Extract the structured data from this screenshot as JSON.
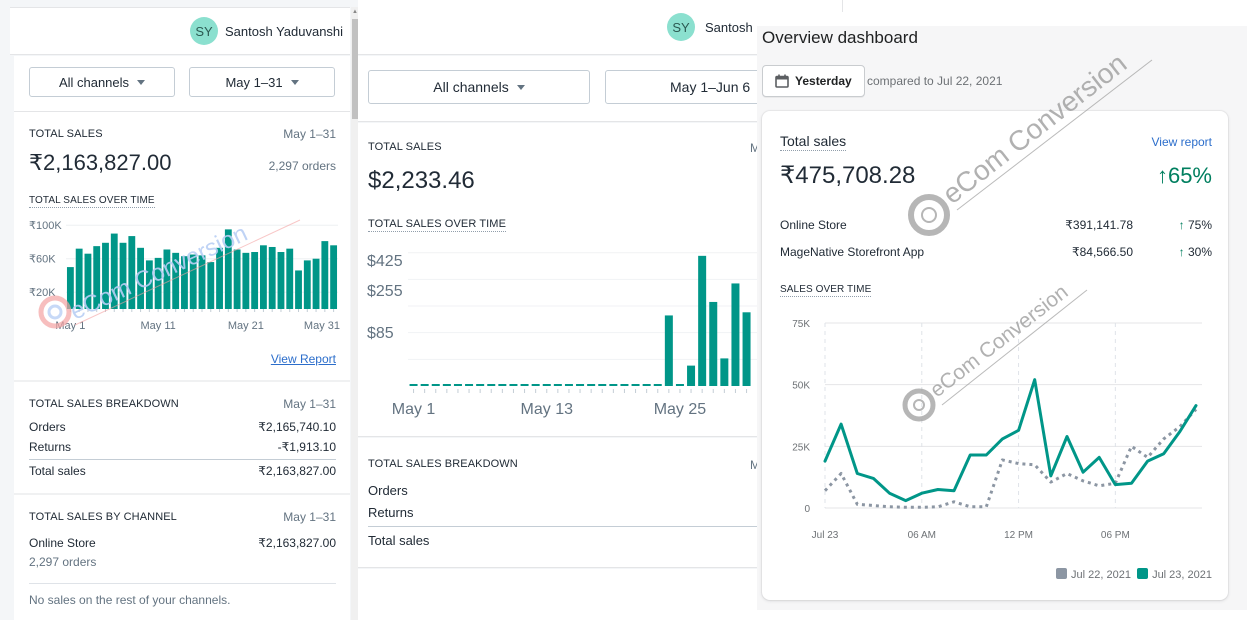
{
  "user": {
    "initials": "SY",
    "name": "Santosh Yaduvanshi",
    "name_short": "Santosh"
  },
  "panel1": {
    "filters": {
      "channel": "All channels",
      "date_range": "May 1–31"
    },
    "total_sales": {
      "label": "TOTAL SALES",
      "period": "May 1–31",
      "value": "₹2,163,827.00",
      "orders": "2,297 orders"
    },
    "chart_title": "TOTAL SALES OVER TIME",
    "view_report": "View Report",
    "breakdown": {
      "title": "TOTAL SALES BREAKDOWN",
      "period": "May 1–31",
      "rows": [
        {
          "label": "Orders",
          "value": "₹2,165,740.10"
        },
        {
          "label": "Returns",
          "value": "-₹1,913.10"
        },
        {
          "label": "Total sales",
          "value": "₹2,163,827.00"
        }
      ]
    },
    "by_channel": {
      "title": "TOTAL SALES BY CHANNEL",
      "period": "May 1–31",
      "channel": "Online Store",
      "value": "₹2,163,827.00",
      "orders": "2,297 orders",
      "note": "No sales on the rest of your channels."
    }
  },
  "panel2": {
    "filters": {
      "channel": "All channels",
      "date_range": "May 1–Jun 6"
    },
    "total_sales": {
      "label": "TOTAL SALES",
      "period_clipped": "M",
      "value": "$2,233.46"
    },
    "chart_title": "TOTAL SALES OVER TIME",
    "breakdown": {
      "title": "TOTAL SALES BREAKDOWN",
      "period_clipped": "M",
      "rows": [
        {
          "label": "Orders"
        },
        {
          "label": "Returns"
        },
        {
          "label": "Total sales"
        }
      ]
    }
  },
  "panel3": {
    "title": "Overview dashboard",
    "date_button": "Yesterday",
    "compare_text": "compared to Jul 22, 2021",
    "total_sales": {
      "label": "Total sales",
      "view_report": "View report",
      "value": "₹475,708.28",
      "change": "65%",
      "channels": [
        {
          "name": "Online Store",
          "value": "₹391,141.78",
          "change": "75%"
        },
        {
          "name": "MageNative Storefront App",
          "value": "₹84,566.50",
          "change": "30%"
        }
      ]
    },
    "chart_title": "SALES OVER TIME"
  },
  "watermark": {
    "text": "eCom Conversion"
  },
  "colors": {
    "teal": "#009688",
    "gray_series": "#8c96a3",
    "link": "#2c6ecb",
    "positive": "#007f5f",
    "avatar": "#8be0cf"
  },
  "chart_data": [
    {
      "type": "bar",
      "title": "TOTAL SALES OVER TIME",
      "xlabel": "",
      "ylabel": "",
      "x_tick_labels": [
        "May 1",
        "May 11",
        "May 21",
        "May 31"
      ],
      "y_tick_labels": [
        "₹100K",
        "₹60K",
        "₹20K"
      ],
      "y_ticks": [
        100,
        60,
        20
      ],
      "ylim": [
        0,
        105
      ],
      "unit": "thousand INR",
      "categories": [
        "May 1",
        "May 2",
        "May 3",
        "May 4",
        "May 5",
        "May 6",
        "May 7",
        "May 8",
        "May 9",
        "May 10",
        "May 11",
        "May 12",
        "May 13",
        "May 14",
        "May 15",
        "May 16",
        "May 17",
        "May 18",
        "May 19",
        "May 20",
        "May 21",
        "May 22",
        "May 23",
        "May 24",
        "May 25",
        "May 26",
        "May 27",
        "May 28",
        "May 29",
        "May 30",
        "May 31"
      ],
      "values": [
        50,
        72,
        66,
        75,
        79,
        90,
        79,
        87,
        73,
        58,
        61,
        71,
        67,
        63,
        65,
        64,
        56,
        73,
        95,
        71,
        67,
        68,
        76,
        74,
        68,
        72,
        46,
        58,
        60,
        81,
        76
      ],
      "grid": true
    },
    {
      "type": "bar",
      "title": "TOTAL SALES OVER TIME",
      "xlabel": "",
      "ylabel": "",
      "x_tick_labels": [
        "May 1",
        "May 13",
        "May 25"
      ],
      "y_tick_labels": [
        "$425",
        "$255",
        "$85"
      ],
      "y_ticks": [
        425,
        255,
        85
      ],
      "gridlines": [
        85,
        170,
        255,
        340,
        425
      ],
      "ylim": [
        0,
        440
      ],
      "unit": "USD",
      "categories": [
        "May 1",
        "May 2",
        "May 3",
        "May 4",
        "May 5",
        "May 6",
        "May 7",
        "May 8",
        "May 9",
        "May 10",
        "May 11",
        "May 12",
        "May 13",
        "May 14",
        "May 15",
        "May 16",
        "May 17",
        "May 18",
        "May 19",
        "May 20",
        "May 21",
        "May 22",
        "May 23",
        "May 24",
        "May 25",
        "May 26",
        "May 27",
        "May 28",
        "May 29",
        "May 30",
        "May 31"
      ],
      "values": [
        0,
        0,
        0,
        0,
        0,
        0,
        0,
        0,
        0,
        0,
        0,
        0,
        0,
        0,
        0,
        0,
        0,
        0,
        0,
        0,
        0,
        0,
        0,
        225,
        0,
        65,
        415,
        268,
        88,
        327,
        235
      ],
      "grid": true
    },
    {
      "type": "line",
      "title": "SALES OVER TIME",
      "xlabel": "",
      "ylabel": "",
      "x": [
        0,
        1,
        2,
        3,
        4,
        5,
        6,
        7,
        8,
        9,
        10,
        11,
        12,
        13,
        14,
        15,
        16,
        17,
        18,
        19,
        20,
        21,
        22,
        23
      ],
      "x_unit": "hour",
      "x_tick_labels": [
        "Jul 23",
        "06 AM",
        "12 PM",
        "06 PM"
      ],
      "x_ticks": [
        0,
        6,
        12,
        18
      ],
      "y_tick_labels": [
        "75K",
        "50K",
        "25K",
        "0"
      ],
      "y_ticks": [
        75,
        50,
        25,
        0
      ],
      "ylim": [
        0,
        75
      ],
      "unit": "thousand INR",
      "legend_position": "bottom-right",
      "series": [
        {
          "name": "Jul 22, 2021",
          "style": "dotted",
          "color": "#8c96a3",
          "values": [
            7,
            14,
            1.5,
            1,
            0.5,
            0.3,
            0.3,
            0.5,
            2.5,
            0.5,
            0.5,
            19.5,
            18,
            17.5,
            10.5,
            14,
            11,
            9,
            10,
            25,
            20.5,
            28,
            33,
            40
          ]
        },
        {
          "name": "Jul 23, 2021",
          "style": "solid",
          "color": "#009688",
          "values": [
            19,
            34,
            14,
            12,
            6,
            3,
            6,
            7.5,
            7,
            21.5,
            21.5,
            28,
            31.5,
            52,
            13,
            29,
            14.5,
            20.5,
            9.5,
            10,
            19,
            22,
            31,
            41.5
          ]
        }
      ],
      "grid": true
    }
  ]
}
